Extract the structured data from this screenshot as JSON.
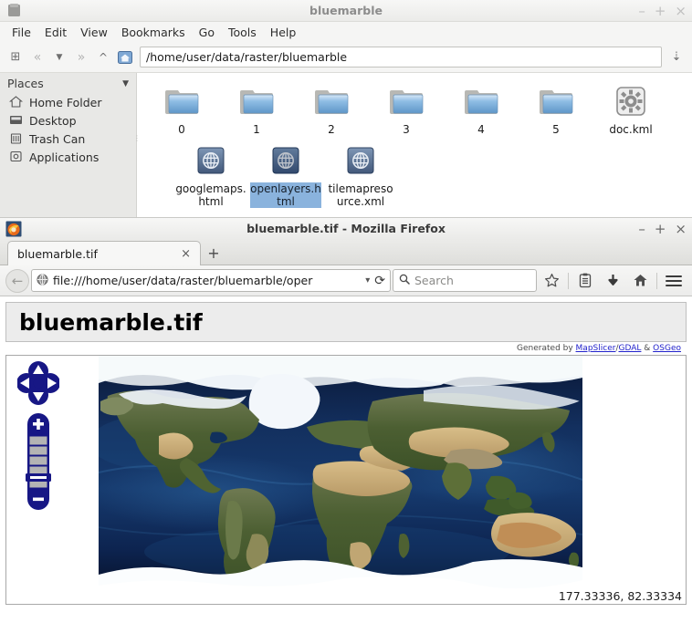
{
  "file_manager": {
    "title": "bluemarble",
    "window_buttons": [
      {
        "name": "minimize",
        "glyph": "–"
      },
      {
        "name": "maximize",
        "glyph": "+"
      },
      {
        "name": "close",
        "glyph": "×"
      }
    ],
    "menus": [
      "File",
      "Edit",
      "View",
      "Bookmarks",
      "Go",
      "Tools",
      "Help"
    ],
    "toolbar": {
      "new_tab_glyph": "⊞",
      "back_glyph": "«",
      "history_glyph": "▼",
      "forward_glyph": "»",
      "up_glyph": "^",
      "home_icon": "home-icon",
      "path": "/home/user/data/raster/bluemarble",
      "path_dropdown_glyph": "⇣"
    },
    "sidebar": {
      "header": "Places",
      "collapse_glyph": "▼",
      "items": [
        {
          "label": "Home Folder",
          "icon": "home-icon"
        },
        {
          "label": "Desktop",
          "icon": "desktop-icon"
        },
        {
          "label": "Trash Can",
          "icon": "trash-icon"
        },
        {
          "label": "Applications",
          "icon": "applications-icon"
        }
      ]
    },
    "files": [
      {
        "label": "0",
        "type": "folder",
        "selected": false
      },
      {
        "label": "1",
        "type": "folder",
        "selected": false
      },
      {
        "label": "2",
        "type": "folder",
        "selected": false
      },
      {
        "label": "3",
        "type": "folder",
        "selected": false
      },
      {
        "label": "4",
        "type": "folder",
        "selected": false
      },
      {
        "label": "5",
        "type": "folder",
        "selected": false
      },
      {
        "label": "doc.kml",
        "type": "gear",
        "selected": false
      },
      {
        "label": "googlemaps.html",
        "type": "web",
        "selected": false
      },
      {
        "label": "openlayers.html",
        "type": "web",
        "selected": true
      },
      {
        "label": "tilemapresource.xml",
        "type": "web",
        "selected": false
      }
    ]
  },
  "firefox": {
    "title": "bluemarble.tif - Mozilla Firefox",
    "window_buttons": [
      {
        "name": "minimize",
        "glyph": "–"
      },
      {
        "name": "maximize",
        "glyph": "+"
      },
      {
        "name": "close",
        "glyph": "×"
      }
    ],
    "tab": {
      "label": "bluemarble.tif",
      "close_glyph": "×",
      "new_tab_glyph": "+"
    },
    "nav": {
      "back_glyph": "←",
      "url": "file:///home/user/data/raster/bluemarble/oper",
      "url_dropdown_glyph": "▾",
      "reload_glyph": "⟳",
      "search_placeholder": "Search",
      "buttons": [
        {
          "name": "bookmark-star-icon",
          "glyph": "☆"
        },
        {
          "name": "reading-list-icon",
          "glyph": "▤"
        },
        {
          "name": "downloads-icon",
          "glyph": "⬇"
        },
        {
          "name": "home-icon",
          "glyph": "⌂"
        },
        {
          "name": "menu-hamburger-icon",
          "glyph": "☰"
        }
      ]
    }
  },
  "page": {
    "title": "bluemarble.tif",
    "generated_prefix": "Generated by ",
    "generated_links": [
      {
        "label": "MapSlicer",
        "sep": "/"
      },
      {
        "label": "GDAL",
        "sep": " & "
      },
      {
        "label": "OSGeo",
        "sep": ""
      }
    ],
    "coordinates": "177.33336, 82.33334",
    "map_controls": {
      "pan_up": "pan-up-button",
      "pan_down": "pan-down-button",
      "pan_left": "pan-left-button",
      "pan_right": "pan-right-button",
      "zoom_in": "+",
      "zoom_out": "–",
      "zoom_levels": 6,
      "zoom_current": 4
    }
  },
  "colors": {
    "accent_link": "#2222cc",
    "selection": "#8ab3dd",
    "map_control": "#1a1a8c",
    "ocean_deep": "#050d28",
    "ocean_mid": "#0d2450",
    "land_green": "#40552a",
    "land_desert": "#c6ac78",
    "ice_white": "#f5f7fa"
  }
}
